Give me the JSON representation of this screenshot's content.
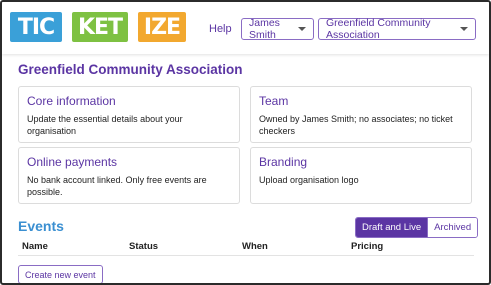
{
  "header": {
    "logo": {
      "text": "TICKETIZE",
      "blocks": [
        {
          "text": "TIC",
          "color": "#3aa0d8"
        },
        {
          "text": "KET",
          "color": "#7ec142"
        },
        {
          "text": "IZE",
          "color": "#f2a82f"
        }
      ]
    },
    "help_label": "Help",
    "user_menu_label": "James Smith",
    "org_menu_label": "Greenfield Community Association"
  },
  "main": {
    "title": "Greenfield Community Association",
    "cards": [
      {
        "title": "Core information",
        "text": "Update the essential details about your organisation"
      },
      {
        "title": "Team",
        "text": "Owned by James Smith; no associates; no ticket checkers"
      },
      {
        "title": "Online payments",
        "text": "No bank account linked. Only free events are possible."
      },
      {
        "title": "Branding",
        "text": "Upload organisation logo"
      }
    ],
    "events": {
      "title": "Events",
      "toggle": {
        "active": "Draft and Live",
        "inactive": "Archived"
      },
      "columns": [
        "Name",
        "Status",
        "When",
        "Pricing"
      ],
      "create_label": "Create new event"
    }
  },
  "colors": {
    "brand": "#5b35a3",
    "events_heading": "#3a8fd1",
    "border": "#8a6cc4"
  }
}
